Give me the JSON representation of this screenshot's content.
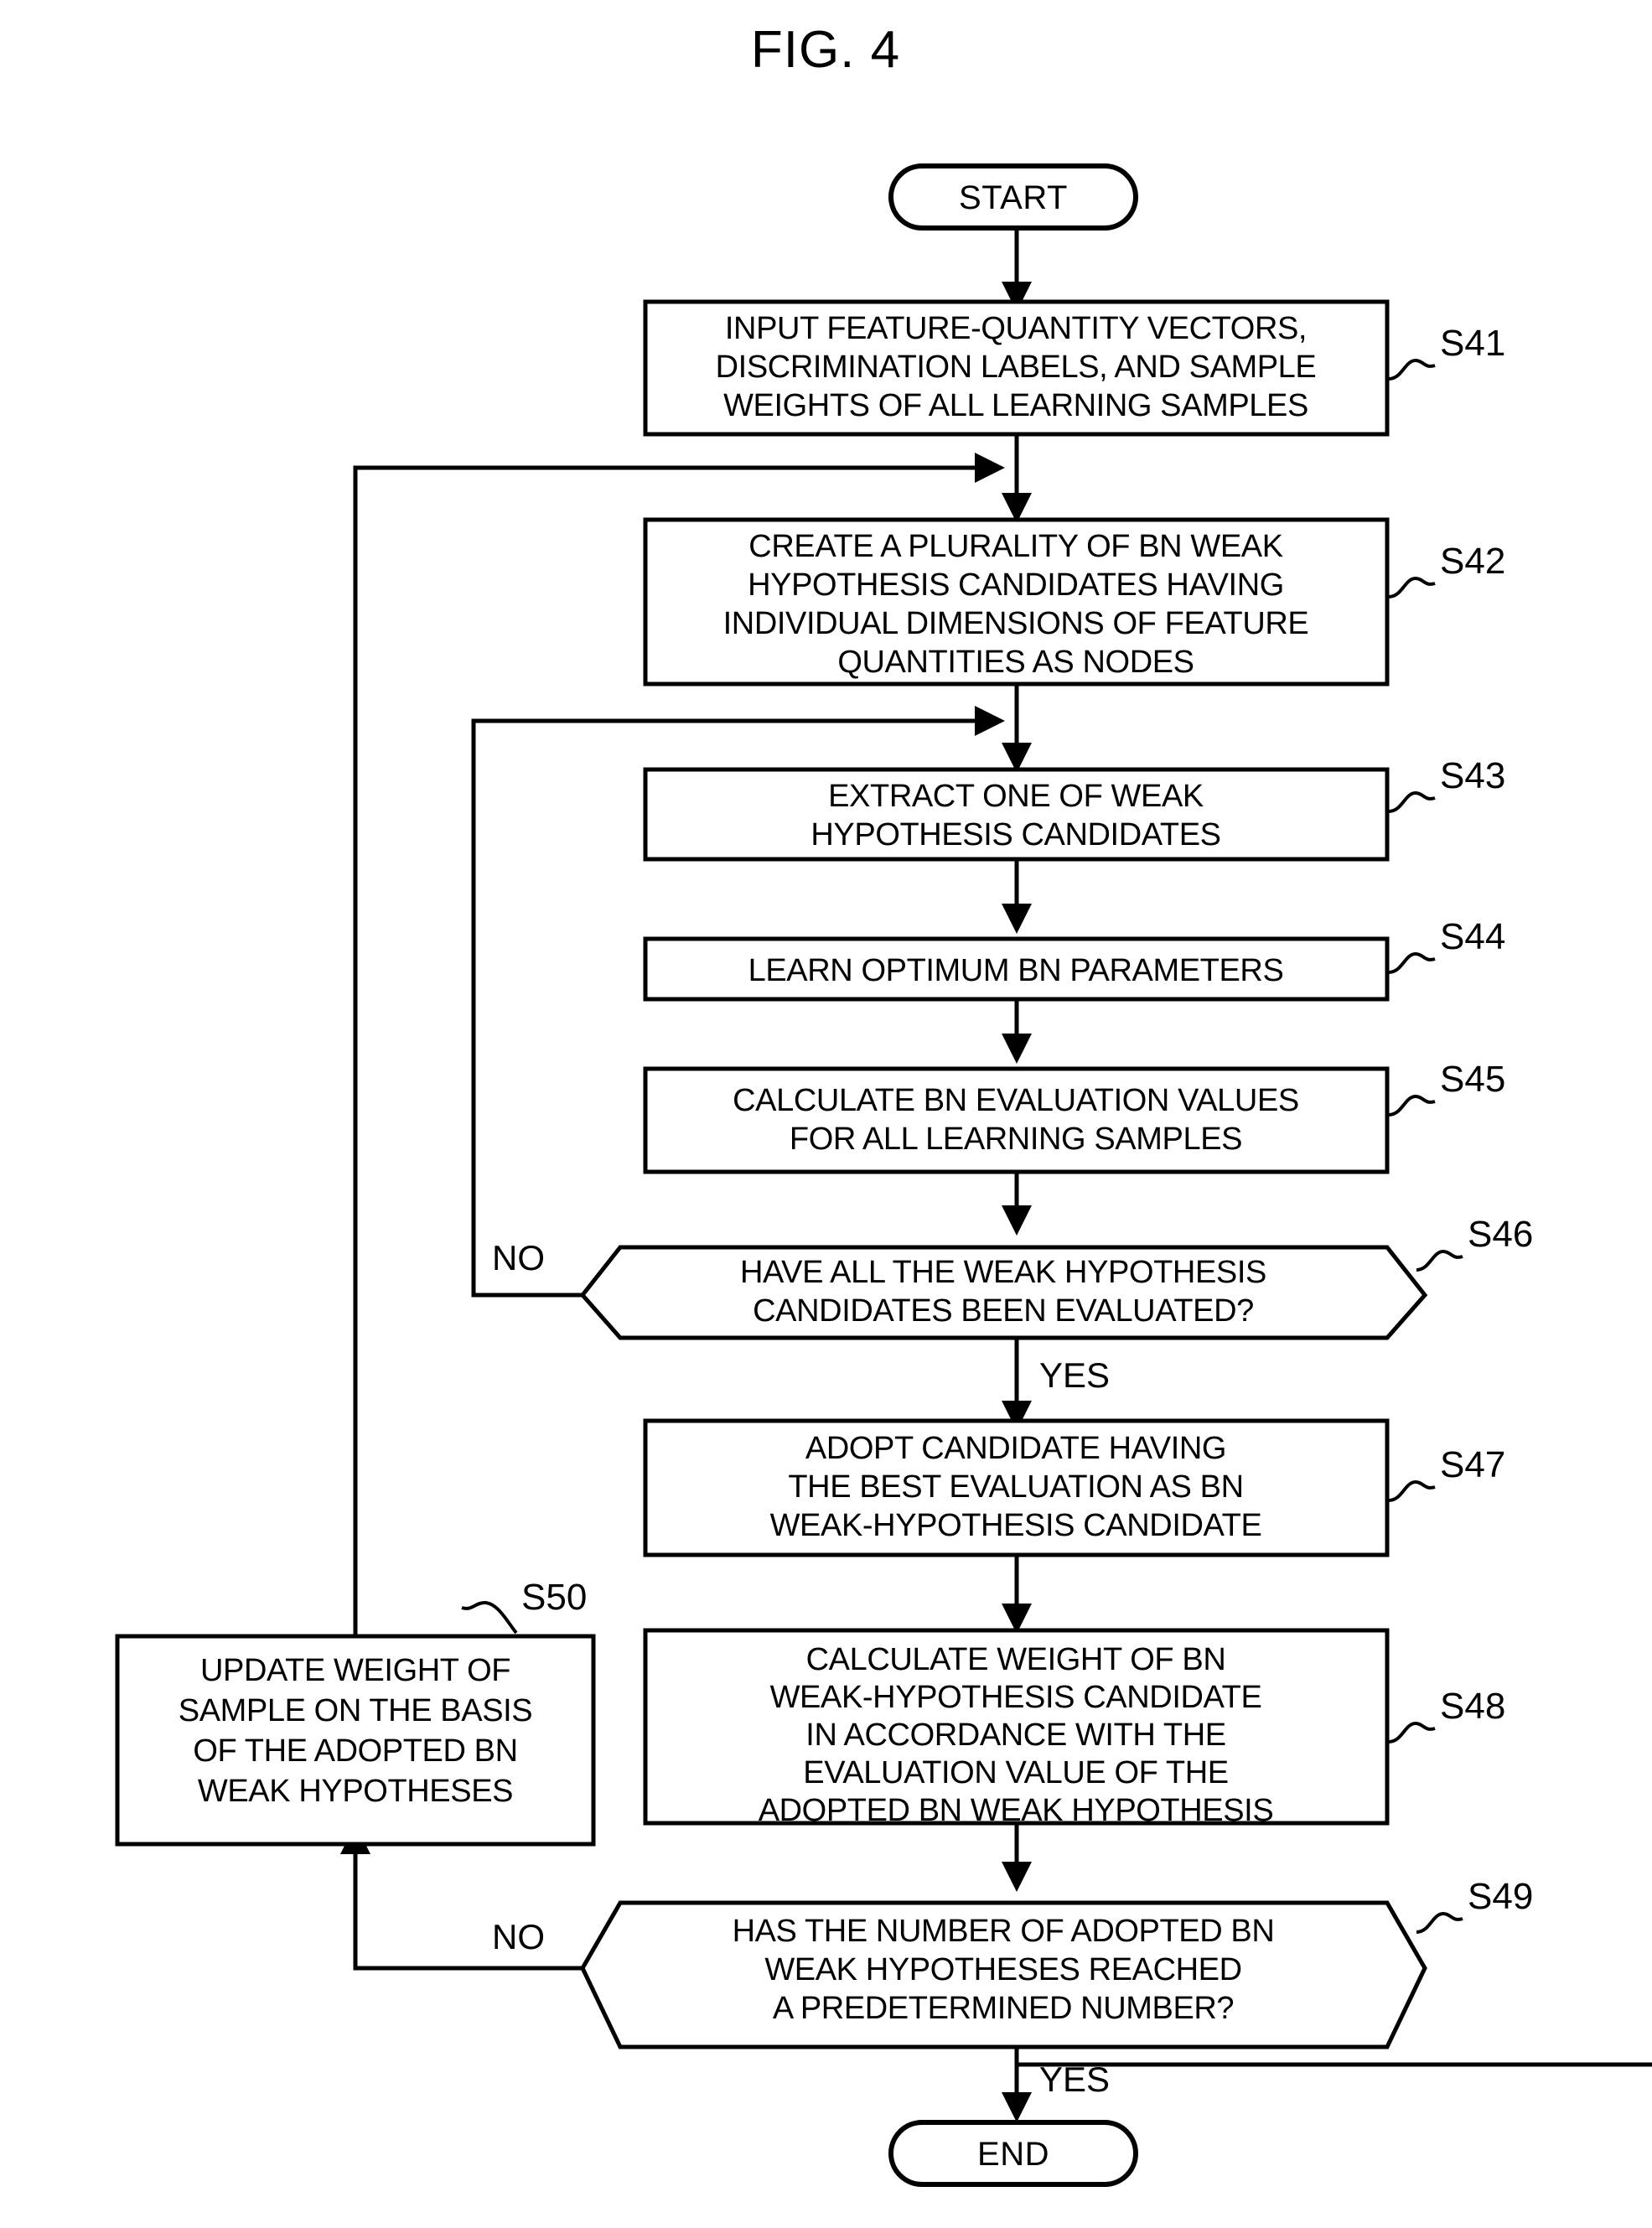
{
  "figure": {
    "title": "FIG. 4"
  },
  "nodes": {
    "start": {
      "label": "START",
      "shape": "terminator"
    },
    "end": {
      "label": "END",
      "shape": "terminator"
    },
    "s41": {
      "ref": "S41",
      "shape": "process",
      "lines": [
        "INPUT FEATURE-QUANTITY VECTORS,",
        "DISCRIMINATION LABELS, AND SAMPLE",
        "WEIGHTS OF ALL LEARNING SAMPLES"
      ]
    },
    "s42": {
      "ref": "S42",
      "shape": "process",
      "lines": [
        "CREATE A PLURALITY OF BN WEAK",
        "HYPOTHESIS CANDIDATES HAVING",
        "INDIVIDUAL DIMENSIONS OF FEATURE",
        "QUANTITIES AS NODES"
      ]
    },
    "s43": {
      "ref": "S43",
      "shape": "process",
      "lines": [
        "EXTRACT ONE OF WEAK",
        "HYPOTHESIS CANDIDATES"
      ]
    },
    "s44": {
      "ref": "S44",
      "shape": "process",
      "lines": [
        "LEARN OPTIMUM BN PARAMETERS"
      ]
    },
    "s45": {
      "ref": "S45",
      "shape": "process",
      "lines": [
        "CALCULATE BN EVALUATION VALUES",
        "FOR ALL LEARNING SAMPLES"
      ]
    },
    "s46": {
      "ref": "S46",
      "shape": "decision",
      "lines": [
        "HAVE ALL THE WEAK HYPOTHESIS",
        "CANDIDATES BEEN EVALUATED?"
      ],
      "no_label": "NO",
      "yes_label": "YES"
    },
    "s47": {
      "ref": "S47",
      "shape": "process",
      "lines": [
        "ADOPT CANDIDATE HAVING",
        "THE BEST EVALUATION AS BN",
        "WEAK-HYPOTHESIS CANDIDATE"
      ]
    },
    "s48": {
      "ref": "S48",
      "shape": "process",
      "lines": [
        "CALCULATE WEIGHT OF BN",
        "WEAK-HYPOTHESIS CANDIDATE",
        "IN ACCORDANCE WITH THE",
        "EVALUATION VALUE OF THE",
        "ADOPTED BN WEAK HYPOTHESIS"
      ]
    },
    "s49": {
      "ref": "S49",
      "shape": "decision",
      "lines": [
        "HAS THE NUMBER OF ADOPTED BN",
        "WEAK HYPOTHESES REACHED",
        "A PREDETERMINED NUMBER?"
      ],
      "no_label": "NO",
      "yes_label": "YES"
    },
    "s50": {
      "ref": "S50",
      "shape": "process",
      "lines": [
        "UPDATE WEIGHT OF",
        "SAMPLE ON THE BASIS",
        "OF THE ADOPTED BN",
        "WEAK HYPOTHESES"
      ]
    }
  },
  "colors": {
    "stroke": "#000000",
    "fill": "#ffffff",
    "text": "#000000"
  }
}
